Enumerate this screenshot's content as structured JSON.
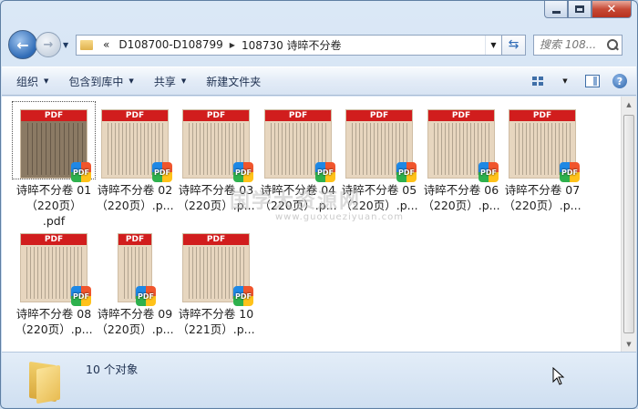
{
  "window": {
    "minimize_icon": "minimize-icon",
    "maximize_icon": "maximize-icon",
    "close_label": "✕"
  },
  "nav": {
    "back_icon": "back-arrow-icon",
    "forward_icon": "forward-arrow-icon",
    "breadcrumb": [
      "«",
      "D108700-D108799",
      "108730 诗晬不分卷"
    ],
    "search_placeholder": "搜索 108..."
  },
  "toolbar": {
    "organize": "组织",
    "include_in_library": "包含到库中",
    "share": "共享",
    "new_folder": "新建文件夹"
  },
  "files": [
    {
      "name": "诗晬不分卷 01\n（220页）\n.pdf",
      "style": "dark"
    },
    {
      "name": "诗晬不分卷 02\n（220页）.p...",
      "style": "normal"
    },
    {
      "name": "诗晬不分卷 03\n（220页）.p...",
      "style": "normal"
    },
    {
      "name": "诗晬不分卷 04\n（220页）.p...",
      "style": "normal"
    },
    {
      "name": "诗晬不分卷 05\n（220页）.p...",
      "style": "normal"
    },
    {
      "name": "诗晬不分卷 06\n（220页）.p...",
      "style": "normal"
    },
    {
      "name": "诗晬不分卷 07\n（220页）.p...",
      "style": "normal"
    },
    {
      "name": "诗晬不分卷 08\n（220页）.p...",
      "style": "normal"
    },
    {
      "name": "诗晬不分卷 09\n（220页）.p...",
      "style": "narrow"
    },
    {
      "name": "诗晬不分卷 10\n（221页）.p...",
      "style": "normal"
    }
  ],
  "thumb_label": "PDF",
  "badge_label": "PDF",
  "watermark": {
    "text": "国学大资源网",
    "url": "www.guoxueziyuan.com"
  },
  "status": {
    "count": "10 个对象"
  },
  "colors": {
    "pdf_red": "#d11d1d",
    "accent_blue": "#2f6bb6",
    "close_red": "#c74a36"
  }
}
